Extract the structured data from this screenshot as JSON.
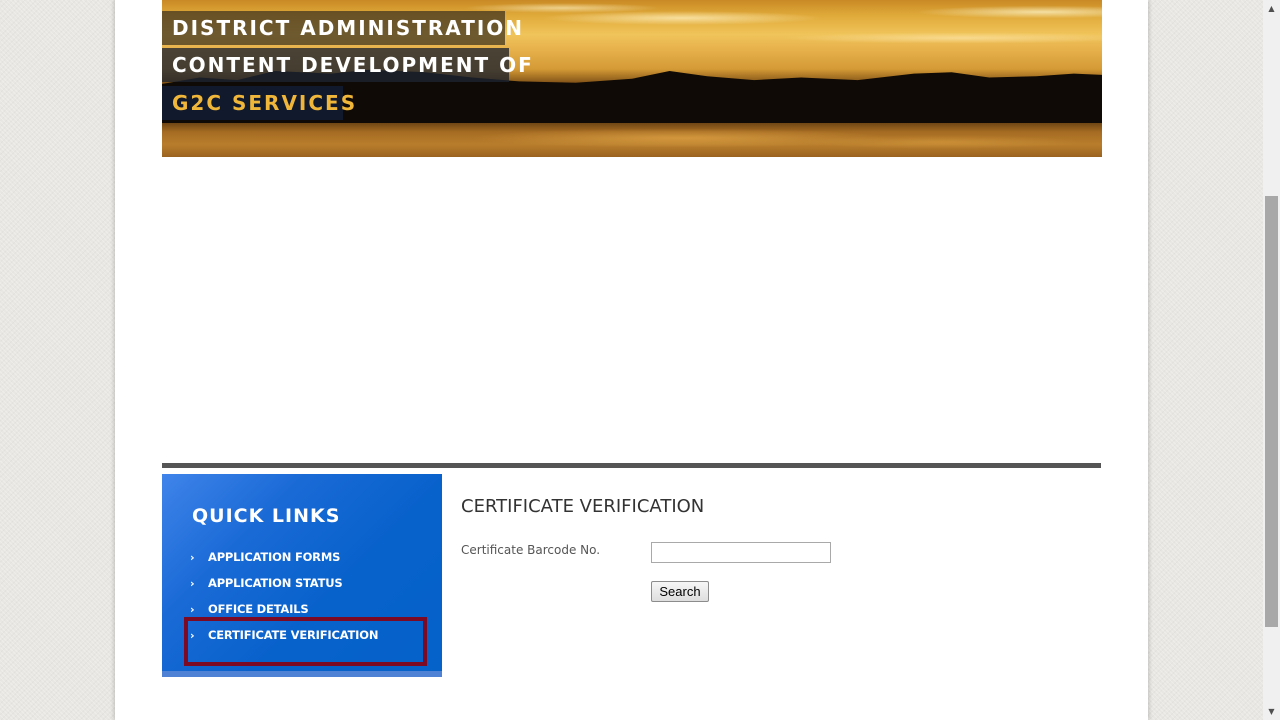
{
  "banner": {
    "caption_line1": "DISTRICT ADMINISTRATION",
    "caption_line2": "CONTENT DEVELOPMENT OF",
    "caption_line3": "G2C SERVICES",
    "caption_line3_color": "#f0b63a",
    "image": "sunset-over-lake-photo"
  },
  "quick_links": {
    "title": "QUICK LINKS",
    "panel_color": "#0462c9",
    "items": [
      {
        "label": "APPLICATION FORMS",
        "icon": "chevron-right-icon"
      },
      {
        "label": "APPLICATION STATUS",
        "icon": "chevron-right-icon"
      },
      {
        "label": "OFFICE DETAILS",
        "icon": "chevron-right-icon"
      },
      {
        "label": "CERTIFICATE VERIFICATION",
        "icon": "chevron-right-icon",
        "highlighted": true
      }
    ],
    "chevron_glyph": "›",
    "highlight_color": "#7c0a25"
  },
  "form": {
    "title": "CERTIFICATE VERIFICATION",
    "barcode_label": "Certificate Barcode No.",
    "barcode_value": "",
    "barcode_placeholder": "",
    "search_label": "Search"
  },
  "scrollbar": {
    "up_glyph": "▲",
    "down_glyph": "▼"
  }
}
